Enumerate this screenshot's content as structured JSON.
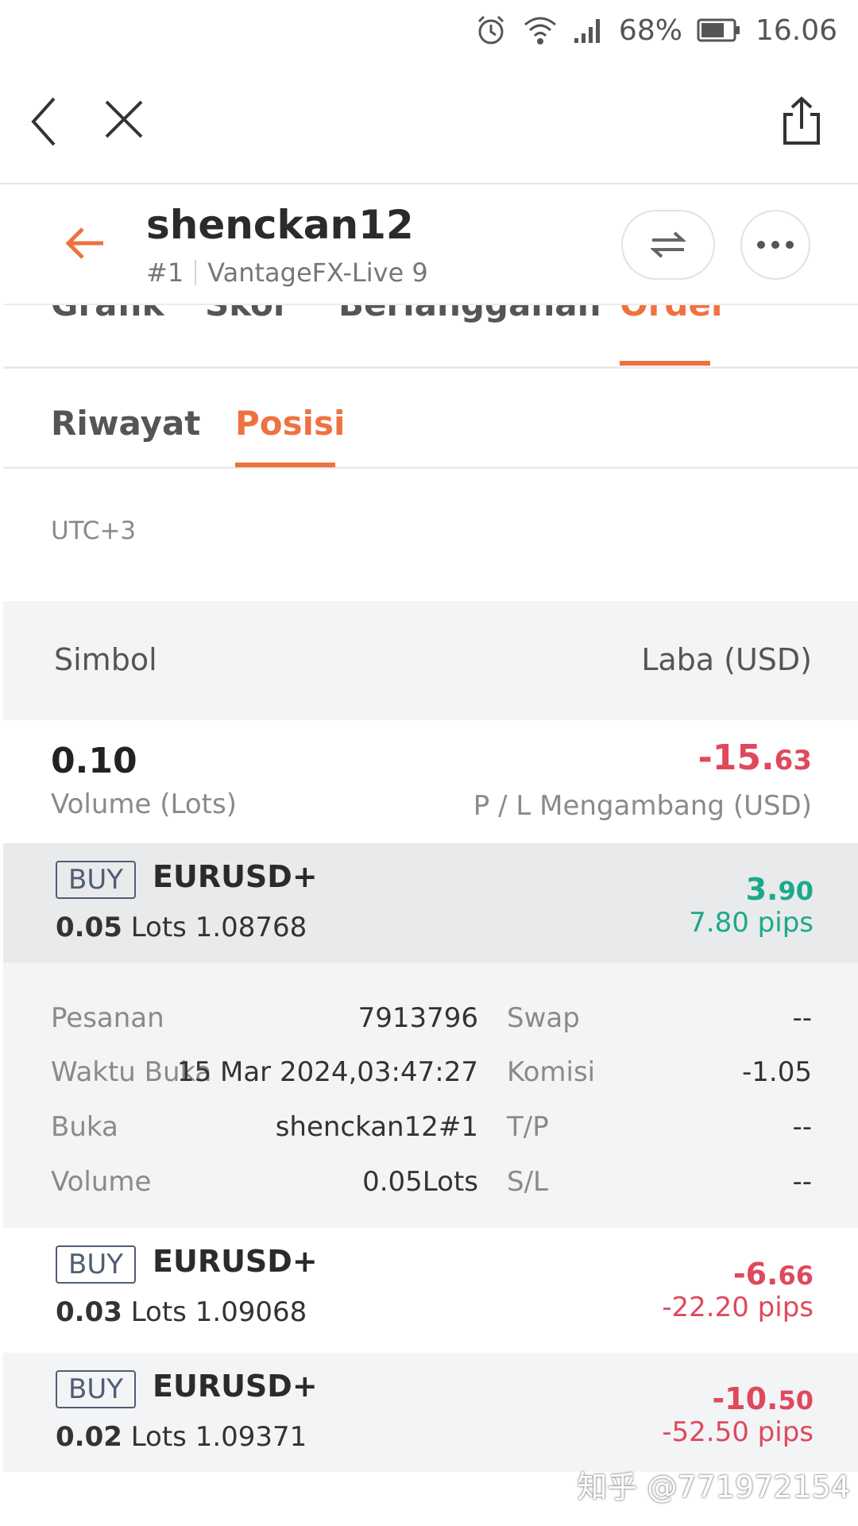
{
  "status": {
    "battery": "68%",
    "time": "16.06"
  },
  "header": {
    "name": "shenckan12",
    "rank": "#1",
    "server": "VantageFX-Live 9"
  },
  "tabs_main": [
    {
      "label": "Grafik"
    },
    {
      "label": "Skor"
    },
    {
      "label": "Berlangganan"
    },
    {
      "label": "Order",
      "active": true
    }
  ],
  "tabs_sub": [
    {
      "label": "Riwayat"
    },
    {
      "label": "Posisi",
      "active": true
    }
  ],
  "timezone": "UTC+3",
  "table_head": {
    "symbol": "Simbol",
    "profit": "Laba (USD)"
  },
  "summary": {
    "volume": "0.10",
    "volume_label": "Volume (Lots)",
    "pl_main": "-15.",
    "pl_decimals": "63",
    "pl_label": "P / L Mengambang (USD)"
  },
  "positions": [
    {
      "side": "BUY",
      "symbol": "EURUSD+",
      "lots": "0.05",
      "lots_word": "Lots",
      "price": "1.08768",
      "profit_main": "3.",
      "profit_dec": "90",
      "pips": "7.80 pips",
      "color": "#1aa98c"
    },
    {
      "side": "BUY",
      "symbol": "EURUSD+",
      "lots": "0.03",
      "lots_word": "Lots",
      "price": "1.09068",
      "profit_main": "-6.",
      "profit_dec": "66",
      "pips": "-22.20 pips",
      "color": "#e0485c"
    },
    {
      "side": "BUY",
      "symbol": "EURUSD+",
      "lots": "0.02",
      "lots_word": "Lots",
      "price": "1.09371",
      "profit_main": "-10.",
      "profit_dec": "50",
      "pips": "-52.50 pips",
      "color": "#e0485c"
    }
  ],
  "detail": {
    "rows": [
      {
        "label": "Pesanan",
        "value": "7913796",
        "label2": "Swap",
        "value2": "--"
      },
      {
        "label": "Waktu Buka",
        "value": "15 Mar 2024,03:47:27",
        "label2": "Komisi",
        "value2": "-1.05"
      },
      {
        "label": "Buka",
        "value": "shenckan12#1",
        "label2": "T/P",
        "value2": "--"
      },
      {
        "label": "Volume",
        "value": "0.05Lots",
        "label2": "S/L",
        "value2": "--"
      }
    ]
  },
  "watermark": "知乎 @771972154"
}
